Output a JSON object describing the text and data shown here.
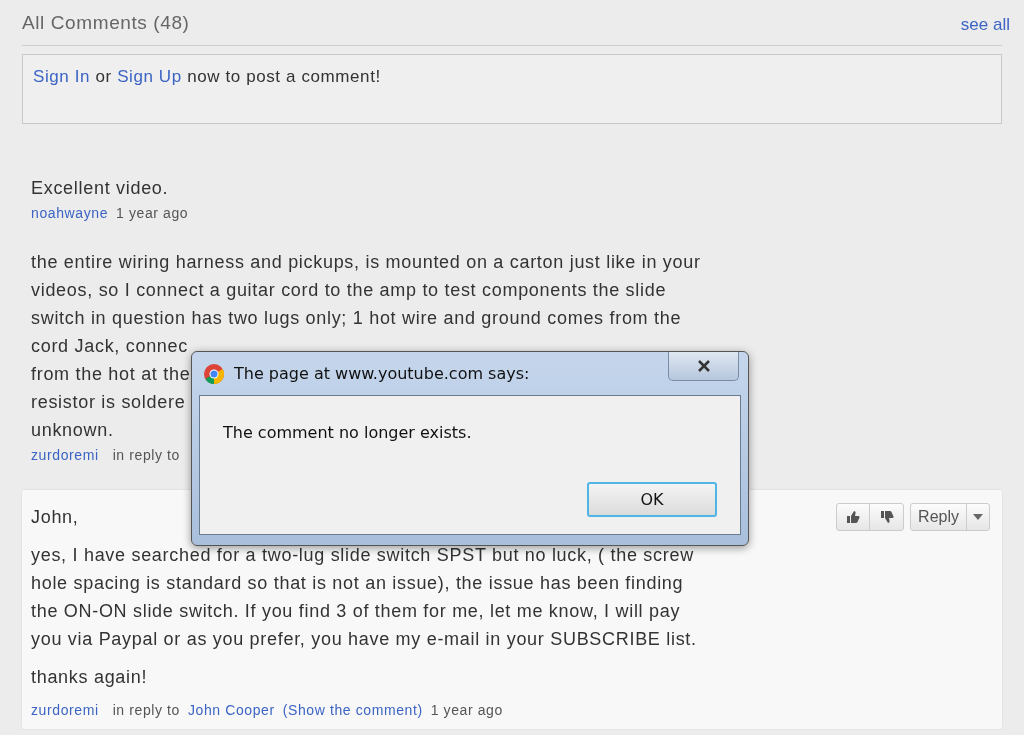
{
  "header": {
    "title": "All Comments (48)",
    "see_all": "see all"
  },
  "sign_in": {
    "sign_in": "Sign In",
    "or": "or",
    "sign_up": "Sign Up",
    "rest": "now to post a comment!"
  },
  "comments": [
    {
      "kind": "plain",
      "lines": [
        "Excellent video."
      ],
      "author": "noahwayne",
      "time": "1 year ago"
    },
    {
      "kind": "plain",
      "lines": [
        "the entire wiring harness and pickups, is mounted on a carton just like in your",
        "videos, so I connect a guitar cord to the amp to test components the slide",
        "switch in question has two lugs only; 1 hot wire and ground comes from the",
        "cord Jack, connec",
        "from the hot at the",
        "resistor is soldere",
        "unknown."
      ],
      "author": "zurdoremi",
      "reply_label": "in reply to"
    },
    {
      "kind": "card",
      "paragraphs": [
        "John,",
        "yes, I have searched for a two-lug slide switch SPST but no luck, ( the screw hole spacing is standard so that is not an issue), the issue has been finding the ON-ON slide switch. If you find 3 of them for me, let me know, I will pay you via Paypal or as you prefer, you have my e-mail in your SUBSCRIBE list.",
        "thanks again!"
      ],
      "author": "zurdoremi",
      "reply_label": "in reply to",
      "reply_to": "John Cooper",
      "show_link": "(Show the comment)",
      "time": "1 year ago",
      "reply_button": "Reply"
    }
  ],
  "dialog": {
    "title": "The page at www.youtube.com says:",
    "message": "The comment no longer exists.",
    "button": "OK"
  }
}
